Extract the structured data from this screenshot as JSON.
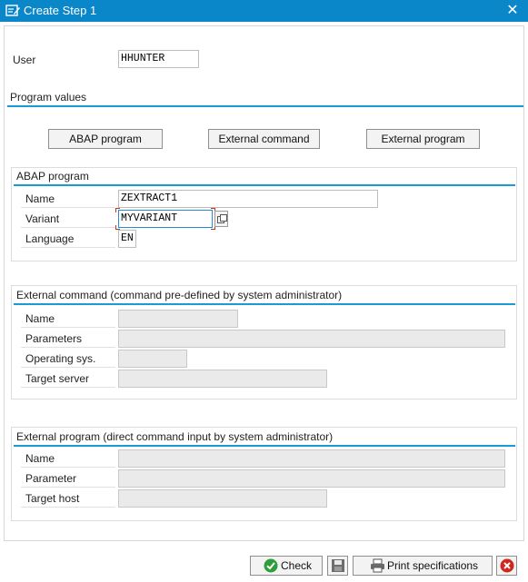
{
  "window": {
    "title": "Create Step  1",
    "close_label": "✕"
  },
  "user": {
    "label": "User",
    "value": "HHUNTER"
  },
  "program_values": {
    "heading": "Program values",
    "buttons": {
      "abap": "ABAP program",
      "ext_command": "External command",
      "ext_program": "External program"
    }
  },
  "abap": {
    "heading": "ABAP program",
    "name_label": "Name",
    "name_value": "ZEXTRACT1",
    "variant_label": "Variant",
    "variant_value": "MYVARIANT",
    "language_label": "Language",
    "language_value": "EN"
  },
  "ext_command": {
    "heading": "External command (command pre-defined by system administrator)",
    "name_label": "Name",
    "name_value": "",
    "parameters_label": "Parameters",
    "parameters_value": "",
    "os_label": "Operating sys.",
    "os_value": "",
    "target_label": "Target server",
    "target_value": ""
  },
  "ext_program": {
    "heading": "External program (direct command input by system administrator)",
    "name_label": "Name",
    "name_value": "",
    "parameter_label": "Parameter",
    "parameter_value": "",
    "target_label": "Target host",
    "target_value": ""
  },
  "footer": {
    "check_label": "Check",
    "print_label": "Print specifications"
  },
  "colors": {
    "titlebar": "#0a87c9",
    "accent": "#1b9ad6",
    "check_green": "#2e9e3a",
    "cancel_red": "#d0281e"
  }
}
